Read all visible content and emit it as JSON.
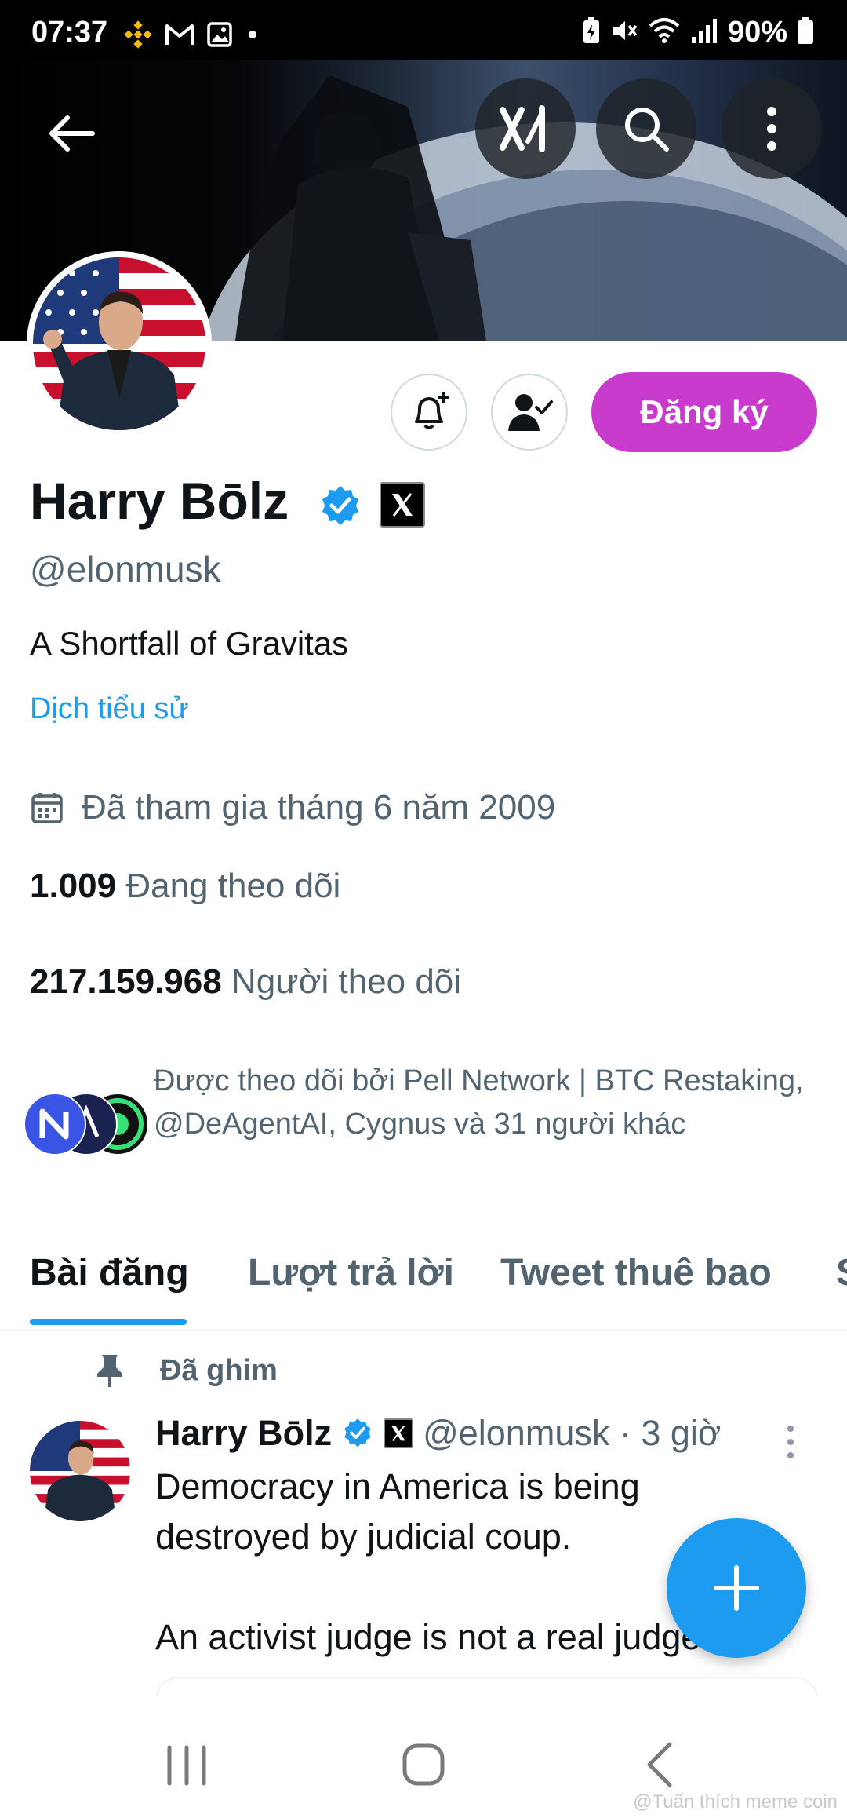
{
  "status_bar": {
    "time": "07:37",
    "battery": "90%",
    "left_icons": [
      "binance-icon",
      "gmail-icon",
      "gallery-icon",
      "dot-icon"
    ],
    "right_icons": [
      "battery-saver-icon",
      "mute-icon",
      "wifi-icon",
      "signal-icon",
      "battery-icon"
    ]
  },
  "header": {
    "buttons": [
      "back-icon",
      "grok-icon",
      "search-icon",
      "more-icon"
    ]
  },
  "profile": {
    "name": "Harry Bōlz",
    "handle": "@elonmusk",
    "bio": "A Shortfall of Gravitas",
    "translate_bio": "Dịch tiểu sử",
    "joined": "Đã tham gia tháng 6 năm 2009",
    "following_count": "1.009",
    "following_label": "Đang theo dõi",
    "followers_count": "217.159.968",
    "followers_label": "Người theo dõi",
    "followed_by": "Được theo dõi bởi Pell Network | BTC Restaking, @DeAgentAI, Cygnus và 31 người khác",
    "subscribe_label": "Đăng ký"
  },
  "tabs": [
    {
      "label": "Bài đăng",
      "active": true
    },
    {
      "label": "Lượt trả lời",
      "active": false
    },
    {
      "label": "Tweet thuê bao",
      "active": false
    },
    {
      "label": "S",
      "active": false
    }
  ],
  "tweet": {
    "pinned_label": "Đã ghim",
    "name": "Harry Bōlz",
    "meta": "@elonmusk · 3 giờ",
    "text": "Democracy in America is being destroyed by judicial coup.\n\nAn activist judge is not a real judge"
  },
  "watermark": "@Tuấn thích meme coin",
  "colors": {
    "accent": "#1d9bf0",
    "subscribe": "#c93bcc",
    "text_primary": "#0f1419",
    "text_secondary": "#536471"
  }
}
